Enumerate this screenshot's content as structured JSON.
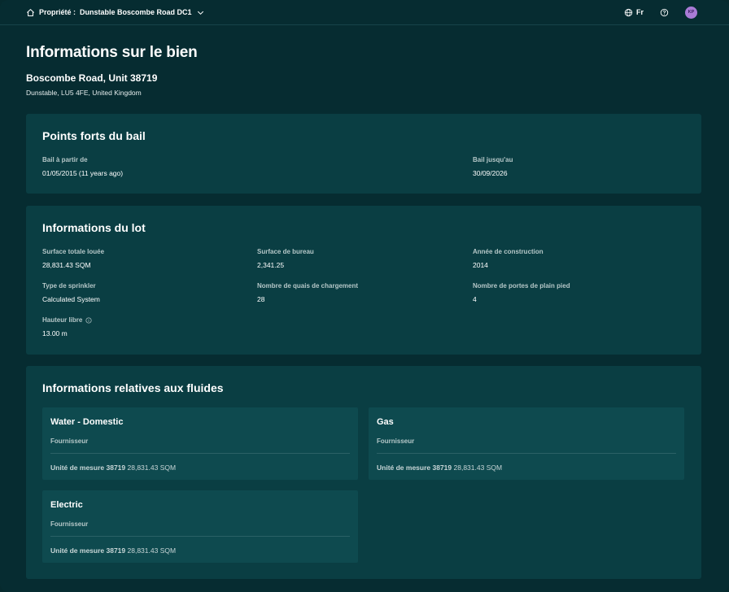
{
  "topbar": {
    "property_prefix": "Propriété :",
    "property_name": "Dunstable Boscombe Road DC1",
    "language": "Fr",
    "avatar_initials": "KP"
  },
  "page": {
    "title": "Informations sur le bien",
    "address_line1": "Boscombe Road, Unit 38719",
    "address_line2": "Dunstable, LU5 4FE, United Kingdom"
  },
  "lease": {
    "title": "Points forts du bail",
    "start_label": "Bail à partir de",
    "start_value": "01/05/2015 (11 years ago)",
    "end_label": "Bail jusqu'au",
    "end_value": "30/09/2026"
  },
  "lot": {
    "title": "Informations du lot",
    "fields": [
      {
        "label": "Surface totale louée",
        "value": "28,831.43 SQM"
      },
      {
        "label": "Surface de bureau",
        "value": "2,341.25"
      },
      {
        "label": "Année de construction",
        "value": "2014"
      },
      {
        "label": "Type de sprinkler",
        "value": "Calculated System"
      },
      {
        "label": "Nombre de quais de chargement",
        "value": "28"
      },
      {
        "label": "Nombre de portes de plain pied",
        "value": "4"
      },
      {
        "label": "Hauteur libre",
        "value": "13.00 m"
      }
    ]
  },
  "utilities": {
    "title": "Informations relatives aux fluides",
    "items": [
      {
        "name": "Water - Domestic",
        "supplier_label": "Fournisseur",
        "measure_label": "Unité de mesure 38719",
        "measure_value": "28,831.43 SQM"
      },
      {
        "name": "Gas",
        "supplier_label": "Fournisseur",
        "measure_label": "Unité de mesure 38719",
        "measure_value": "28,831.43 SQM"
      },
      {
        "name": "Electric",
        "supplier_label": "Fournisseur",
        "measure_label": "Unité de mesure 38719",
        "measure_value": "28,831.43 SQM"
      }
    ]
  },
  "colors": {
    "background": "#062c31",
    "card": "#0a3e43",
    "utility_card": "#0e4a4f",
    "avatar": "#a97bd6"
  }
}
